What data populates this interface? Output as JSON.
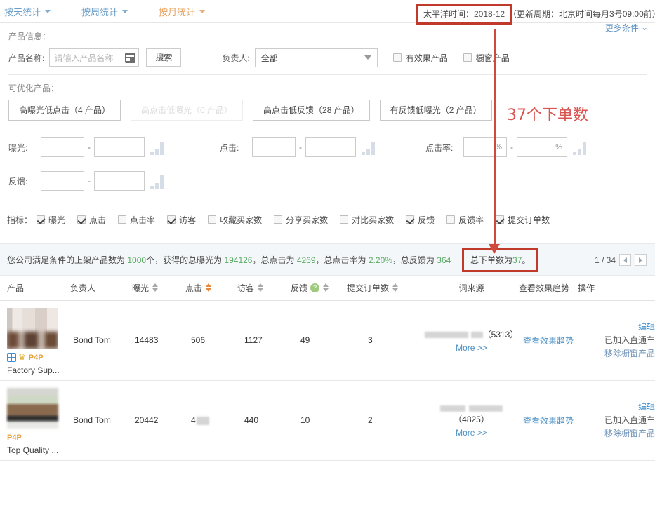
{
  "tabs": [
    {
      "label": "按天统计",
      "active": false
    },
    {
      "label": "按周统计",
      "active": false
    },
    {
      "label": "按月统计",
      "active": true
    }
  ],
  "header": {
    "date_label": "太平洋时间：2018-12",
    "update_note": "（更新周期：北京时间每月3号09:00前）"
  },
  "filters": {
    "section_label": "产品信息：",
    "product_name_label": "产品名称:",
    "product_name_placeholder": "请输入产品名称",
    "product_name_value": "",
    "search_button": "搜索",
    "owner_label": "负责人:",
    "owner_value": "全部",
    "effective_product_label": "有效果产品",
    "showcase_product_label": "橱窗产品",
    "more_conditions": "更多条件"
  },
  "optimizable": {
    "label": "可优化产品：",
    "buttons": [
      {
        "label": "高曝光低点击（4 产品）",
        "disabled": false
      },
      {
        "label": "高点击低曝光（0 产品）",
        "disabled": true
      },
      {
        "label": "高点击低反馈（28 产品）",
        "disabled": false
      },
      {
        "label": "有反馈低曝光（2 产品）",
        "disabled": false
      }
    ]
  },
  "ranges": [
    {
      "label": "曝光:",
      "from": "",
      "to": "",
      "unit": ""
    },
    {
      "label": "点击:",
      "from": "",
      "to": "",
      "unit": ""
    },
    {
      "label": "点击率:",
      "from": "",
      "to": "",
      "unit": "%"
    },
    {
      "label": "反馈:",
      "from": "",
      "to": "",
      "unit": ""
    }
  ],
  "metrics": {
    "label": "指标：",
    "items": [
      {
        "label": "曝光",
        "checked": true
      },
      {
        "label": "点击",
        "checked": true
      },
      {
        "label": "点击率",
        "checked": false
      },
      {
        "label": "访客",
        "checked": true
      },
      {
        "label": "收藏买家数",
        "checked": false
      },
      {
        "label": "分享买家数",
        "checked": false
      },
      {
        "label": "对比买家数",
        "checked": false
      },
      {
        "label": "反馈",
        "checked": true
      },
      {
        "label": "反馈率",
        "checked": false
      },
      {
        "label": "提交订单数",
        "checked": true
      }
    ]
  },
  "summary": {
    "prefix": "您公司满足条件的上架产品数为",
    "products": "1000",
    "mid1": "个，获得的总曝光为",
    "impressions": "194126",
    "mid2": "，总点击为",
    "clicks": "4269",
    "mid3": "，总点击率为",
    "ctr": "2.20%",
    "mid4": "，总反馈为",
    "feedback": "364",
    "orders_text_prefix": "总下单数为",
    "orders_value": "37",
    "orders_suffix": "。",
    "page_indicator": "1 / 34"
  },
  "table": {
    "columns": [
      {
        "label": "产品",
        "sortable": false,
        "active": false
      },
      {
        "label": "负责人",
        "sortable": false,
        "active": false
      },
      {
        "label": "曝光",
        "sortable": true,
        "active": false
      },
      {
        "label": "点击",
        "sortable": true,
        "active": true
      },
      {
        "label": "访客",
        "sortable": true,
        "active": false
      },
      {
        "label": "反馈",
        "sortable": true,
        "active": false,
        "help": "?"
      },
      {
        "label": "提交订单数",
        "sortable": true,
        "active": false
      },
      {
        "label": "词来源",
        "sortable": false,
        "active": false
      },
      {
        "label": "查看效果趋势",
        "sortable": false,
        "active": false
      },
      {
        "label": "操作",
        "sortable": false,
        "active": false
      }
    ],
    "rows": [
      {
        "badges": [
          "grid-icon",
          "crown-icon"
        ],
        "p4p": "P4P",
        "product_name": "Factory Sup...",
        "owner": "Bond Tom",
        "impressions": "14483",
        "clicks": "506",
        "visitors": "1127",
        "feedback": "49",
        "orders": "3",
        "keyword_count": "（5313）",
        "more_link": "More >>",
        "trend_link": "查看效果趋势",
        "op_edit": "编辑",
        "op_joined": "已加入直通车",
        "op_remove": "移除橱窗产品"
      },
      {
        "badges": [],
        "p4p": "P4P",
        "product_name": "Top Quality ...",
        "owner": "Bond Tom",
        "impressions": "20442",
        "clicks": "4",
        "visitors": "440",
        "feedback": "10",
        "orders": "2",
        "keyword_count": "（4825）",
        "more_link": "More >>",
        "trend_link": "查看效果趋势",
        "op_edit": "编辑",
        "op_joined": "已加入直通车",
        "op_remove": "移除橱窗产品"
      }
    ]
  },
  "annotation": {
    "text": "37个下单数",
    "color": "#d9534f"
  }
}
